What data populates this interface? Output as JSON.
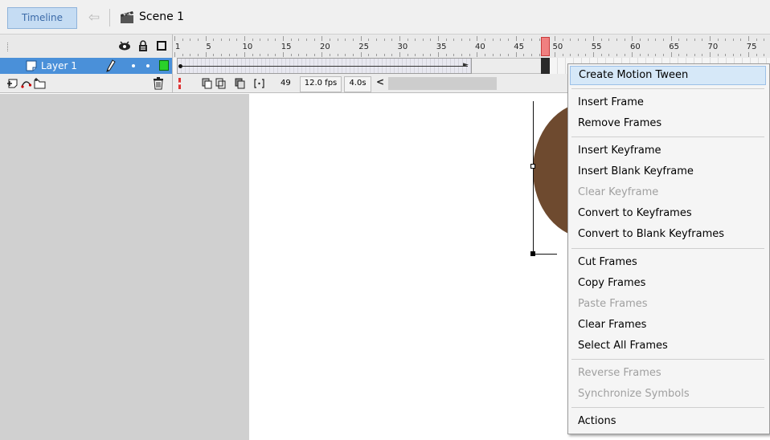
{
  "toolbar": {
    "timeline_label": "Timeline",
    "scene_name": "Scene 1"
  },
  "ruler": {
    "labels": [
      "1",
      "5",
      "10",
      "15",
      "20",
      "25",
      "30",
      "35",
      "40",
      "45",
      "50",
      "55",
      "60",
      "65",
      "70",
      "75"
    ]
  },
  "layer": {
    "name": "Layer 1",
    "color": "#2ad12a"
  },
  "status": {
    "current_frame": "49",
    "fps": "12.0 fps",
    "elapsed": "4.0s",
    "scroll_left_label": "<"
  },
  "menu": {
    "items": [
      {
        "label": "Create Motion Tween",
        "enabled": true,
        "highlighted": true
      },
      {
        "label": "Insert Frame",
        "enabled": true
      },
      {
        "label": "Remove Frames",
        "enabled": true
      },
      {
        "label": "Insert Keyframe",
        "enabled": true
      },
      {
        "label": "Insert Blank Keyframe",
        "enabled": true
      },
      {
        "label": "Clear Keyframe",
        "enabled": false
      },
      {
        "label": "Convert to Keyframes",
        "enabled": true
      },
      {
        "label": "Convert to Blank Keyframes",
        "enabled": true
      },
      {
        "label": "Cut Frames",
        "enabled": true
      },
      {
        "label": "Copy Frames",
        "enabled": true
      },
      {
        "label": "Paste Frames",
        "enabled": false
      },
      {
        "label": "Clear Frames",
        "enabled": true
      },
      {
        "label": "Select All Frames",
        "enabled": true
      },
      {
        "label": "Reverse Frames",
        "enabled": false
      },
      {
        "label": "Synchronize Symbols",
        "enabled": false
      },
      {
        "label": "Actions",
        "enabled": true
      }
    ]
  },
  "colors": {
    "layer_selected": "#4a90d9",
    "playhead": "#f08080",
    "pasteboard": "#d0d0d0",
    "circle_fill": "#6e4a2f",
    "menu_highlight": "#d6e8f8"
  },
  "icons": {
    "back": "back-arrow-icon",
    "scene": "clapperboard-icon",
    "show_hide": "eye-icon",
    "lock": "lock-icon",
    "outline": "outline-square-icon",
    "edit": "pencil-icon",
    "delete_layer": "trash-icon"
  }
}
